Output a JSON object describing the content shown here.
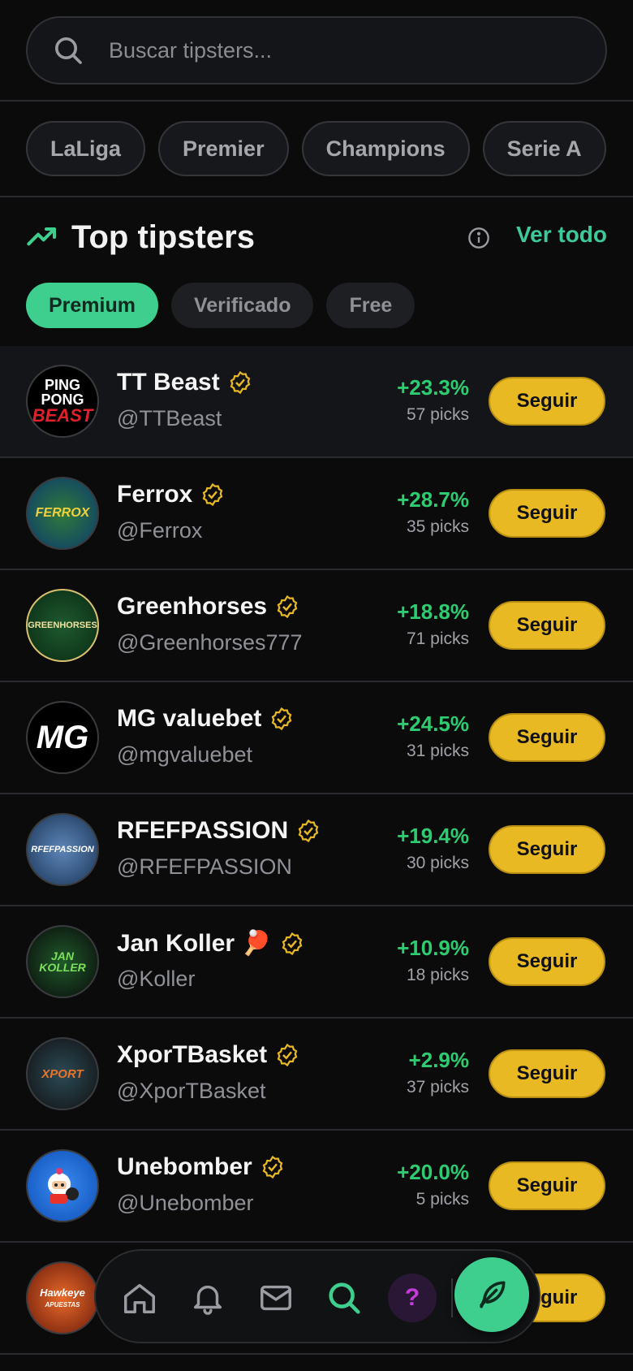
{
  "search": {
    "placeholder": "Buscar tipsters..."
  },
  "leagues": [
    "LaLiga",
    "Premier",
    "Champions",
    "Serie A"
  ],
  "section": {
    "title": "Top tipsters",
    "see_all": "Ver todo"
  },
  "filters": [
    "Premium",
    "Verificado",
    "Free"
  ],
  "tipsters": [
    {
      "name": "TT Beast",
      "handle": "@TTBeast",
      "roi": "+23.3%",
      "picks": "57 picks",
      "follow": "Seguir",
      "avatar_text": "PING PONG BEAST"
    },
    {
      "name": "Ferrox",
      "handle": "@Ferrox",
      "roi": "+28.7%",
      "picks": "35 picks",
      "follow": "Seguir",
      "avatar_text": "FERROX"
    },
    {
      "name": "Greenhorses",
      "handle": "@Greenhorses777",
      "roi": "+18.8%",
      "picks": "71 picks",
      "follow": "Seguir",
      "avatar_text": "GREENHORSES"
    },
    {
      "name": "MG valuebet",
      "handle": "@mgvaluebet",
      "roi": "+24.5%",
      "picks": "31 picks",
      "follow": "Seguir",
      "avatar_text": "MG"
    },
    {
      "name": "RFEFPASSION",
      "handle": "@RFEFPASSION",
      "roi": "+19.4%",
      "picks": "30 picks",
      "follow": "Seguir",
      "avatar_text": "RFEFPASSION"
    },
    {
      "name": "Jan Koller 🏓",
      "handle": "@Koller",
      "roi": "+10.9%",
      "picks": "18 picks",
      "follow": "Seguir",
      "avatar_text": "JAN KOLLER"
    },
    {
      "name": "XporTBasket",
      "handle": "@XporTBasket",
      "roi": "+2.9%",
      "picks": "37 picks",
      "follow": "Seguir",
      "avatar_text": "XPORT"
    },
    {
      "name": "Unebomber",
      "handle": "@Unebomber",
      "roi": "+20.0%",
      "picks": "5 picks",
      "follow": "Seguir",
      "avatar_text": ""
    },
    {
      "name": "",
      "handle": "",
      "roi": "",
      "picks": "",
      "follow": "Seguir",
      "avatar_text": "Hawkeye APUESTAS"
    }
  ],
  "nav": {
    "help_label": "?"
  },
  "colors": {
    "accent_green": "#3ecf8e",
    "roi_green": "#2ecc71",
    "follow_yellow": "#e8b923",
    "verified_gold": "#e8b923"
  }
}
